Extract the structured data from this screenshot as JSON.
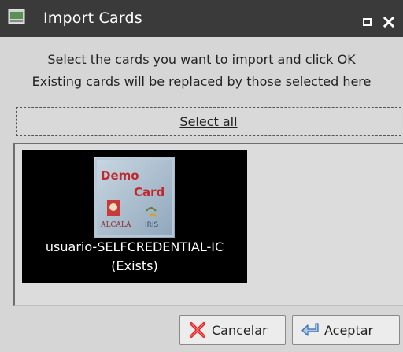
{
  "window": {
    "title": "Import Cards"
  },
  "instructions": {
    "line1": "Select the cards you want to import and click OK",
    "line2": "Existing cards will be replaced by those selected here"
  },
  "select_all": {
    "label": "Select all"
  },
  "cards": [
    {
      "image_text_top": "Demo",
      "image_text_bottom": "Card",
      "image_text_small": "ALCALÁ",
      "image_text_iris": "IRIS",
      "name": "usuario-SELFCREDENTIAL-IC",
      "status": "(Exists)"
    }
  ],
  "buttons": {
    "cancel_label": "Cancelar",
    "accept_label": "Aceptar"
  },
  "colors": {
    "titlebar": "#3a3a3a",
    "window_bg": "#d6d6d6",
    "card_tile_bg": "#000000",
    "card_text": "#ffffff"
  },
  "icons": {
    "title": "window-app-icon",
    "maximize": "maximize-icon",
    "close": "close-icon",
    "cancel": "cancel-x-icon",
    "accept": "enter-arrow-icon"
  }
}
